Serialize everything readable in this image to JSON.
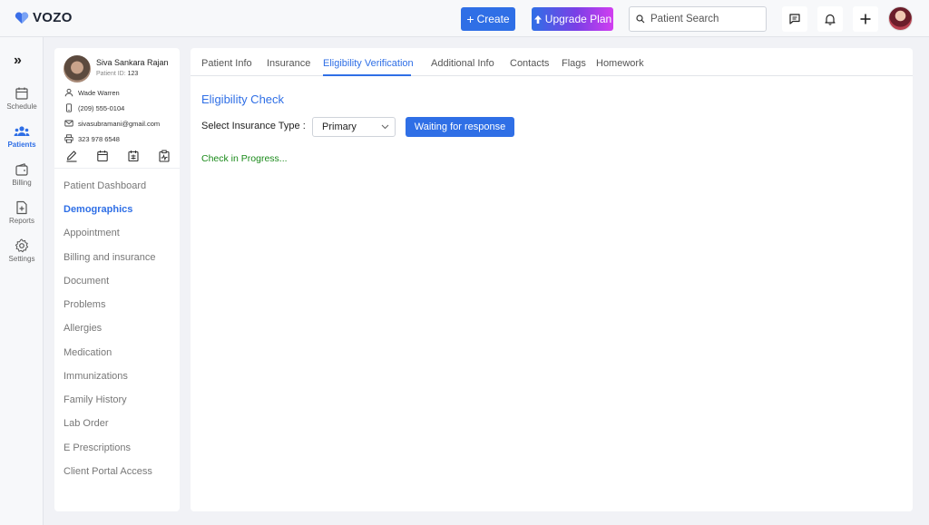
{
  "brand": {
    "name": "VOZO",
    "logo_color": "#3b6fe8",
    "accent": "#2f6fe6"
  },
  "header": {
    "create_label": "Create",
    "upgrade_label": "Upgrade Plan",
    "search_placeholder": "Patient Search",
    "icons": [
      "chat-icon",
      "bell-icon",
      "plus-icon",
      "avatar"
    ]
  },
  "rail": {
    "toggle_icon": "»",
    "items": [
      {
        "label": "Schedule",
        "icon": "calendar-icon"
      },
      {
        "label": "Patients",
        "icon": "users-icon",
        "active": true
      },
      {
        "label": "Billing",
        "icon": "wallet-icon"
      },
      {
        "label": "Reports",
        "icon": "report-icon"
      },
      {
        "label": "Settings",
        "icon": "gear-icon"
      }
    ]
  },
  "patient": {
    "name": "Siva Sankara Rajan",
    "id_label": "Patient ID:",
    "id_value": "123",
    "provider": "Wade Warren",
    "phone": "(209) 555-0104",
    "email": "sivasubramani@gmail.com",
    "fax": "323 978 6548",
    "actions": [
      "edit-icon",
      "calendar-icon",
      "document-icon",
      "medical-icon"
    ]
  },
  "patient_nav": [
    {
      "label": "Patient Dashboard"
    },
    {
      "label": "Demographics",
      "active": true
    },
    {
      "label": "Appointment"
    },
    {
      "label": "Billing and insurance"
    },
    {
      "label": "Document"
    },
    {
      "label": "Problems"
    },
    {
      "label": "Allergies"
    },
    {
      "label": "Medication"
    },
    {
      "label": "Immunizations"
    },
    {
      "label": "Family History"
    },
    {
      "label": "Lab Order"
    },
    {
      "label": "E Prescriptions"
    },
    {
      "label": "Client Portal Access"
    }
  ],
  "tabs": [
    {
      "label": "Patient Info"
    },
    {
      "label": "Insurance"
    },
    {
      "label": "Eligibility Verification",
      "active": true
    },
    {
      "label": "Additional Info"
    },
    {
      "label": "Contacts"
    },
    {
      "label": "Flags"
    },
    {
      "label": "Homework"
    }
  ],
  "eligibility": {
    "title": "Eligibility Check",
    "select_label": "Select Insurance Type :",
    "selected_value": "Primary",
    "status_button": "Waiting for response",
    "progress_text": "Check in Progress..."
  }
}
